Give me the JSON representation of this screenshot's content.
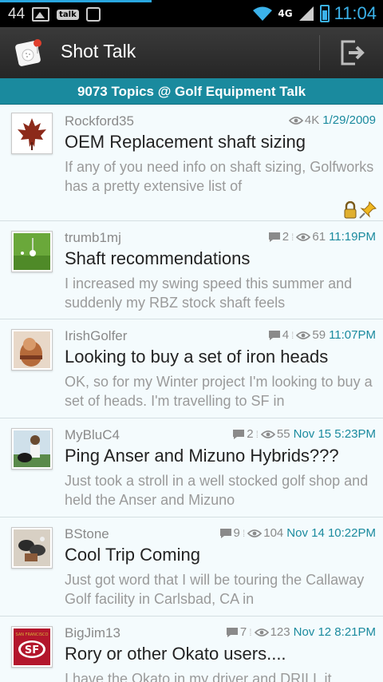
{
  "status_bar": {
    "notification_count": "44",
    "talk_label": "talk",
    "network_label": "4G",
    "time": "11:04"
  },
  "app": {
    "title": "Shot Talk"
  },
  "forum": {
    "header": "9073 Topics @ Golf Equipment Talk"
  },
  "topics": [
    {
      "username": "Rockford35",
      "replies": "",
      "views": "4K",
      "time": "1/29/2009",
      "title": "OEM Replacement shaft sizing",
      "preview": "If any of you need info on shaft sizing, Golfworks has a pretty extensive list of",
      "locked": true,
      "pinned": true,
      "avatar": "maple-leaf"
    },
    {
      "username": "trumb1mj",
      "replies": "2",
      "views": "61",
      "time": "11:19PM",
      "title": "Shaft recommendations",
      "preview": "I increased my swing speed this summer and suddenly my RBZ stock shaft feels",
      "avatar": "golf-ball-on-grass"
    },
    {
      "username": "IrishGolfer",
      "replies": "4",
      "views": "59",
      "time": "11:07PM",
      "title": "Looking to buy a set of iron heads",
      "preview": "OK, so for my Winter project I'm looking to buy a set of heads. I'm travelling to SF in",
      "avatar": "person-photo"
    },
    {
      "username": "MyBluC4",
      "replies": "2",
      "views": "55",
      "time": "Nov 15 5:23PM",
      "title": "Ping Anser and Mizuno Hybrids???",
      "preview": "Just took a stroll in a well stocked golf shop and held the Anser and Mizuno",
      "avatar": "person-with-dog"
    },
    {
      "username": "BStone",
      "replies": "9",
      "views": "104",
      "time": "Nov 14 10:22PM",
      "title": "Cool Trip Coming",
      "preview": "Just got word that I will be touring the Callaway Golf facility in Carlsbad, CA in",
      "avatar": "golf-clubs"
    },
    {
      "username": "BigJim13",
      "replies": "7",
      "views": "123",
      "time": "Nov 12 8:21PM",
      "title": "Rory or other Okato users....",
      "preview": "I have the Okato in my driver and DRILL it.",
      "avatar": "49ers-logo",
      "avatar_text": "SAN FRANCISCO"
    }
  ],
  "colors": {
    "accent": "#1a8a9e",
    "status_blue": "#3bb2ea",
    "list_bg": "#f4fbfd"
  }
}
